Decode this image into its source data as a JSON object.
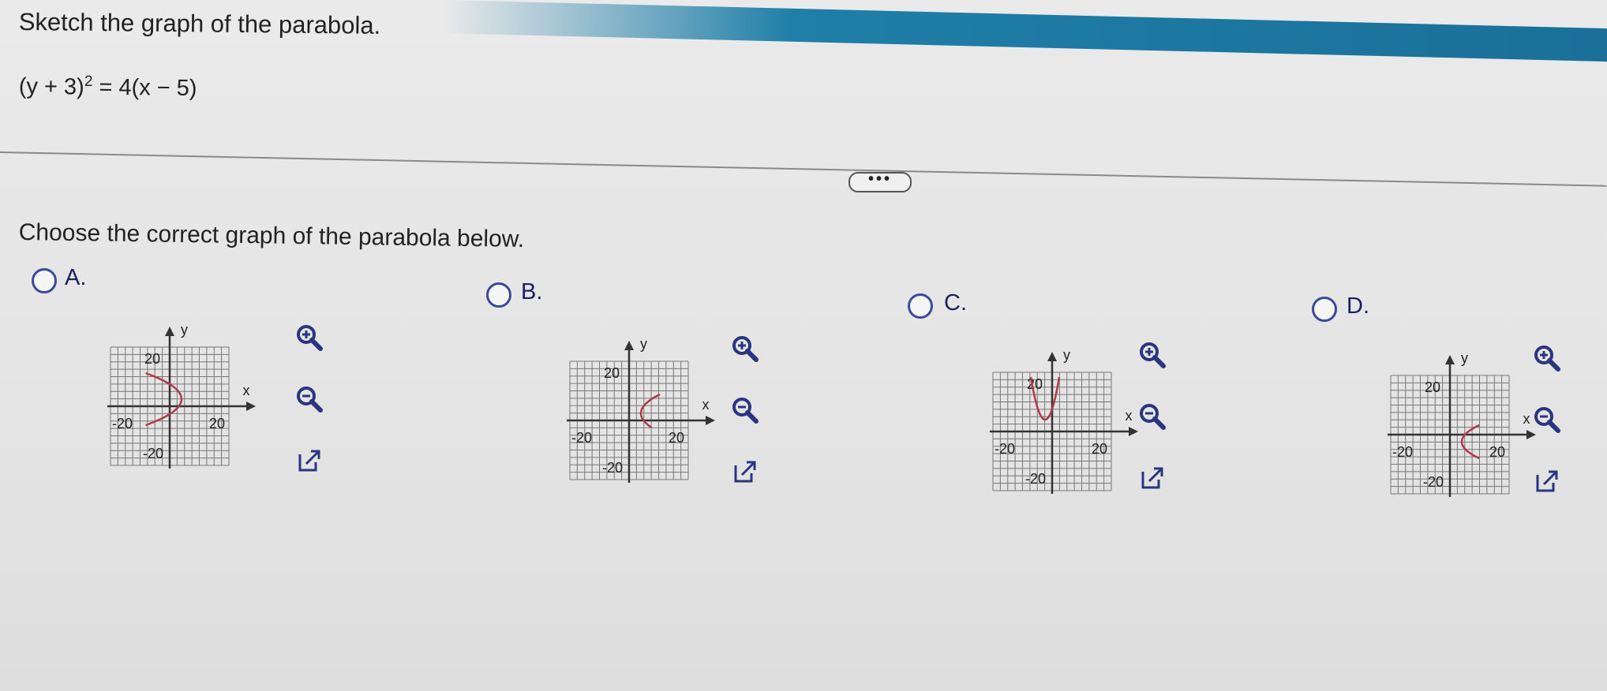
{
  "question": {
    "title": "Sketch the graph of the parabola.",
    "equation_left": "(y + 3)",
    "equation_exp": "2",
    "equation_right": " = 4(x − 5)",
    "more_label": "•••",
    "prompt": "Choose the correct graph of the parabola below."
  },
  "options": [
    {
      "letter": "A.",
      "axis_x": "x",
      "axis_y": "y",
      "tick_pos": "20",
      "tick_neg": "-20",
      "tick_xpos": "20",
      "tick_xneg": "-20"
    },
    {
      "letter": "B.",
      "axis_x": "x",
      "axis_y": "y",
      "tick_pos": "20",
      "tick_neg": "-20",
      "tick_xpos": "20",
      "tick_xneg": "-20"
    },
    {
      "letter": "C.",
      "axis_x": "x",
      "axis_y": "y",
      "tick_pos": "20",
      "tick_neg": "-20",
      "tick_xpos": "20",
      "tick_xneg": "-20"
    },
    {
      "letter": "D.",
      "axis_x": "x",
      "axis_y": "y",
      "tick_pos": "20",
      "tick_neg": "-20",
      "tick_xpos": "20",
      "tick_xneg": "-20"
    }
  ],
  "colors": {
    "curve": "#b03a48",
    "radio": "#3a4a9a",
    "icon": "#2a3580",
    "grid": "#777777",
    "accent_bar": "#1f7fa8"
  },
  "icons": [
    "zoom-in-icon",
    "zoom-out-icon",
    "open-new-window-icon"
  ]
}
